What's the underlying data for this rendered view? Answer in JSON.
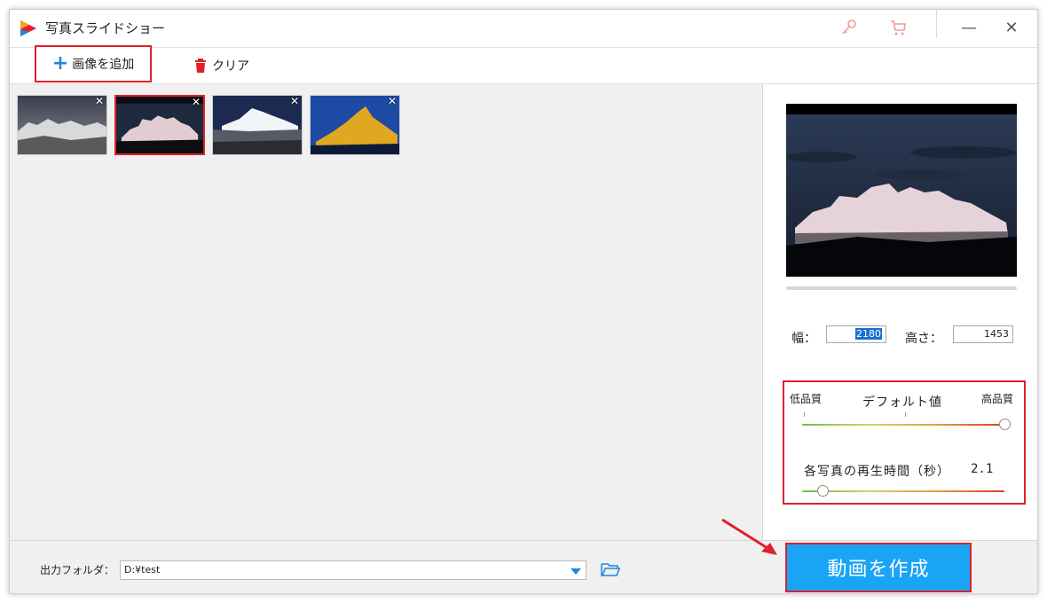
{
  "app": {
    "title": "写真スライドショー",
    "brand_colors": [
      "#e0202a",
      "#1f86e0",
      "#f6a21e"
    ]
  },
  "titlebar": {
    "icons": [
      "key-icon",
      "cart-icon"
    ],
    "minimize": "—",
    "close": "✕"
  },
  "toolbar": {
    "add_image_label": "画像を追加",
    "clear_label": "クリア"
  },
  "photos": {
    "items": [
      {
        "name": "photo-1",
        "selected": false
      },
      {
        "name": "photo-2",
        "selected": true
      },
      {
        "name": "photo-3",
        "selected": false
      },
      {
        "name": "photo-4",
        "selected": false
      }
    ],
    "remove_glyph": "✕"
  },
  "preview": {
    "width_label": "幅：",
    "width_value": "2180",
    "height_label": "高さ：",
    "height_value": "1453"
  },
  "quality": {
    "low_label": "低品質",
    "default_label": "デフォルト値",
    "high_label": "高品質",
    "level_fraction": 1.0
  },
  "duration": {
    "label": "各写真の再生時間（秒）",
    "value": "2.1",
    "level_fraction": 0.1
  },
  "output": {
    "label": "出力フォルダ：",
    "path": "D:¥test"
  },
  "create_button": {
    "label": "動画を作成",
    "color": "#1aa4f5"
  }
}
